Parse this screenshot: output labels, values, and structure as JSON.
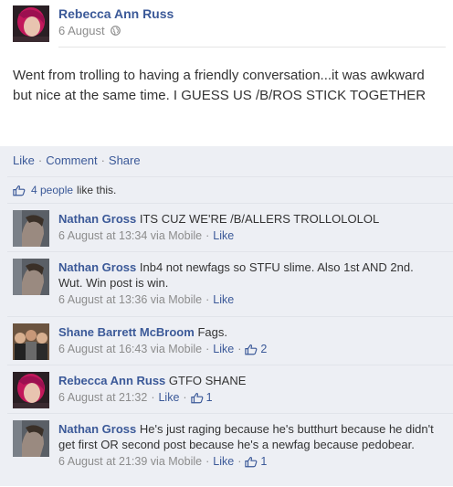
{
  "post": {
    "author": "Rebecca Ann Russ",
    "date": "6 August",
    "text": "Went from trolling to having a friendly conversation...it was awkward but nice at the same time. I GUESS US /B/ROS STICK TOGETHER",
    "privacy_icon": "globe-icon"
  },
  "actions": {
    "like": "Like",
    "comment": "Comment",
    "share": "Share",
    "separator": "·"
  },
  "likes": {
    "count_text": "4 people",
    "suffix": "like this."
  },
  "comments": [
    {
      "author": "Nathan Gross",
      "text": "ITS CUZ WE'RE /B/ALLERS TROLLOLOLOL",
      "time": "6 August at 13:34",
      "via": "via Mobile",
      "like_label": "Like",
      "like_count": ""
    },
    {
      "author": "Nathan Gross",
      "text": "Inb4 not newfags so STFU slime. Also 1st AND 2nd. Wut. Win post is win.",
      "time": "6 August at 13:36",
      "via": "via Mobile",
      "like_label": "Like",
      "like_count": ""
    },
    {
      "author": "Shane Barrett McBroom",
      "text": "Fags.",
      "time": "6 August at 16:43",
      "via": "via Mobile",
      "like_label": "Like",
      "like_count": "2"
    },
    {
      "author": "Rebecca Ann Russ",
      "text": "GTFO SHANE",
      "time": "6 August at 21:32",
      "via": "",
      "like_label": "Like",
      "like_count": "1"
    },
    {
      "author": "Nathan Gross",
      "text": "He's just raging because he's butthurt because he didn't get first OR second post because he's a newfag because pedobear.",
      "time": "6 August at 21:39",
      "via": "via Mobile",
      "like_label": "Like",
      "like_count": "1"
    }
  ],
  "colors": {
    "link": "#3b5998",
    "ufi_background": "#edeff4",
    "meta": "#8c8c8c"
  }
}
